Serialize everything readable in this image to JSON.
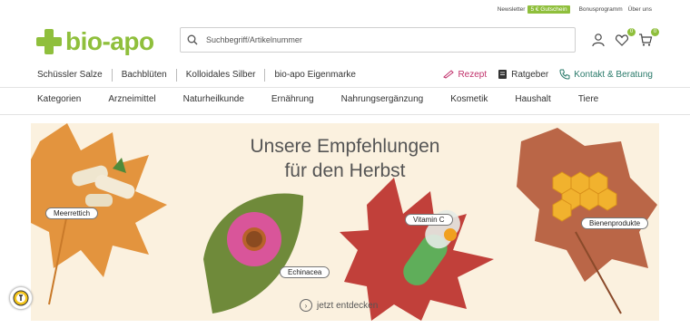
{
  "topbar": {
    "newsletter": "Newsletter",
    "voucher": "5 € Gutschein",
    "bonus": "Bonusprogramm",
    "about": "Über uns"
  },
  "brand": {
    "name": "bio-apo",
    "accent": "#8fbf3c"
  },
  "search": {
    "placeholder": "Suchbegriff/Artikelnummer"
  },
  "header_icons": {
    "wishlist_count": "0",
    "cart_count": "0"
  },
  "subnav": [
    "Schüssler Salze",
    "Bachblüten",
    "Kolloidales Silber",
    "bio-apo Eigenmarke"
  ],
  "right_links": {
    "rezept": "Rezept",
    "ratgeber": "Ratgeber",
    "kontakt": "Kontakt & Beratung"
  },
  "categories": [
    "Kategorien",
    "Arzneimittel",
    "Naturheilkunde",
    "Ernährung",
    "Nahrungsergänzung",
    "Kosmetik",
    "Haushalt",
    "Tiere"
  ],
  "banner": {
    "headline_1": "Unsere Empfehlungen",
    "headline_2": "für den Herbst",
    "cta": "jetzt entdecken",
    "tags": [
      "Meerrettich",
      "Echinacea",
      "Vitamin C",
      "Bienenprodukte"
    ]
  }
}
